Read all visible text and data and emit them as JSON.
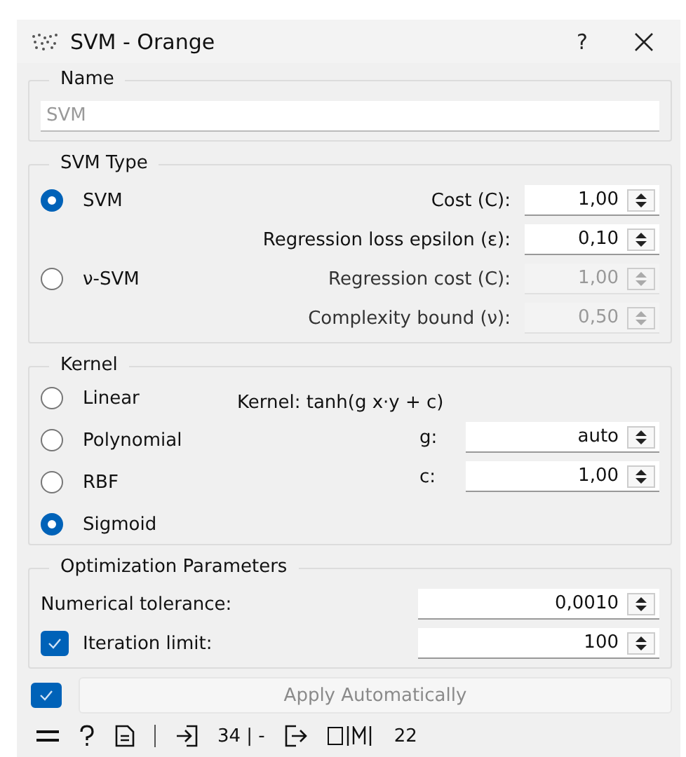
{
  "window": {
    "title": "SVM - Orange",
    "help": "?"
  },
  "name_group": {
    "title": "Name",
    "placeholder": "SVM"
  },
  "svm_type": {
    "title": "SVM Type",
    "options": [
      {
        "label": "SVM",
        "selected": true
      },
      {
        "label": "ν-SVM",
        "selected": false
      }
    ],
    "params": [
      {
        "label": "Cost (C):",
        "value": "1,00",
        "disabled": false
      },
      {
        "label": "Regression loss epsilon (ε):",
        "value": "0,10",
        "disabled": false
      },
      {
        "label": "Regression cost (C):",
        "value": "1,00",
        "disabled": true
      },
      {
        "label": "Complexity bound (ν):",
        "value": "0,50",
        "disabled": true
      }
    ]
  },
  "kernel": {
    "title": "Kernel",
    "formula": "Kernel: tanh(g x⋅y + c)",
    "options": [
      {
        "label": "Linear",
        "selected": false
      },
      {
        "label": "Polynomial",
        "selected": false
      },
      {
        "label": "RBF",
        "selected": false
      },
      {
        "label": "Sigmoid",
        "selected": true
      }
    ],
    "params": [
      {
        "label": "g:",
        "value": "auto"
      },
      {
        "label": "c:",
        "value": "1,00"
      }
    ]
  },
  "optimization": {
    "title": "Optimization Parameters",
    "params": [
      {
        "kind": "plain",
        "label": "Numerical tolerance:",
        "value": "0,0010"
      },
      {
        "kind": "checkable",
        "label": "Iteration limit:",
        "value": "100",
        "checked": true
      }
    ]
  },
  "apply": {
    "checked": true,
    "label": "Apply Automatically",
    "disabled": true
  },
  "status_bar": {
    "input_summary": "34 | -",
    "output_summary": "22"
  }
}
